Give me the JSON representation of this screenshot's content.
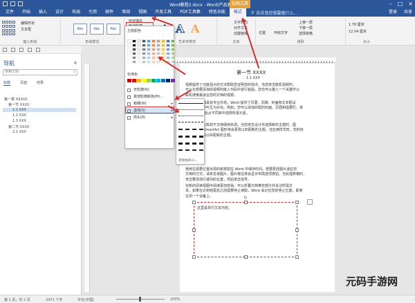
{
  "window": {
    "title": "Word教程2.docx - Word(产品激活失败)",
    "context_tab_group": "绘图工具"
  },
  "tabs": [
    "文件",
    "开始",
    "插入",
    "设计",
    "布局",
    "引用",
    "邮件",
    "审阅",
    "视图",
    "开发工具",
    "PDF工具集",
    "特色功能",
    "格式"
  ],
  "active_tab": "格式",
  "tell_me": "告诉我您想要做什么...",
  "account": [
    "登录",
    "共享"
  ],
  "ribbon": {
    "group_labels": [
      "插入形状",
      "形状样式",
      "艺术字样式",
      "文本",
      "排列",
      "大小"
    ],
    "shape_fill": "形状填充",
    "shape_outline": "形状轮廓",
    "shape_effects": "形状效果",
    "edit_shape": "编辑形状",
    "draw_textbox": "文本框",
    "style_sample": "Abc",
    "text_direction": "文字方向",
    "align_text": "对齐文本",
    "create_link": "创建链接",
    "position": "位置",
    "wrap_text": "环绕文字",
    "bring_forward": "上移一层",
    "send_backward": "下移一层",
    "selection_pane": "选择窗格",
    "height": "1.78 厘米",
    "width": "12.04 厘米",
    "wordart": "A"
  },
  "outline_menu": {
    "theme_colors": "主题颜色",
    "standard_colors": "标准色",
    "no_outline": "无轮廓(N)",
    "more_colors": "其他轮廓颜色(M)...",
    "weight": "粗细(W)",
    "dashes": "虚线(S)",
    "arrows": "箭头(R)",
    "more_lines": "其他线条(L)..."
  },
  "nav": {
    "title": "导航",
    "search_placeholder": "搜索文档",
    "tabs": [
      "标题",
      "页面",
      "结果"
    ],
    "items": [
      "第一章 XXXXX",
      "第一节 XXXX",
      "1.1 XXX",
      "1.2 XXX",
      "1.3 XXX",
      "第二节 XXXX",
      "2.1 XXX"
    ]
  },
  "document": {
    "heading": "第一节  XXXX",
    "subheading": "1.1 XXX",
    "para1": [
      "视频提供了功能强大的方法帮助您证明您的观点。当您单击联机视频时，",
      "可以在想要添加的视频的嵌入代码中进行粘贴。您也可以键入一个关键字以",
      "联机搜索最适合您的文档的视频。"
    ],
    "para2": [
      "为使您的文档具有专业外观，Word 提供了页眉、页脚、封面和文本框设",
      "计，这些设计可互为补充。例如，您可以添加匹配的封面、页眉和提要栏。单",
      "击'插入'，然后从不同库中选择所需元素。"
    ],
    "para3": [
      "主题和样式也有助于文档保持协调。当您单击设计并选择新的主题时，图",
      "片、图表或 SmartArt 图形将会更改以匹配新的主题。当应用样式时，您的标",
      "题会进行更改以匹配新的主题。"
    ],
    "para4": [
      "使用在需要位置出现的新按钮在 Word 中保存时间。若要更改图片适应您",
      "文档的方式，请单击该图片，图片旁边将会显示布局选项按钮。当处理表格时，",
      "单击要添加行或列的位置，然后单击加号。"
    ],
    "para5": [
      "在新的阅读视图中阅读更加容易。可以折叠文档某些部分并关注所需文",
      "本。如果在达到结尾处之前需要停止读取，Word 会记住您的停止位置，即使",
      "在另一个设备上。"
    ],
    "textbox_text": "这里是单行文本内容。"
  },
  "status": {
    "page": "第 1 页，共 2 页",
    "words": "2471 个字",
    "lang": "中文(中国)",
    "zoom": "100%"
  },
  "watermark": "元码手游网"
}
